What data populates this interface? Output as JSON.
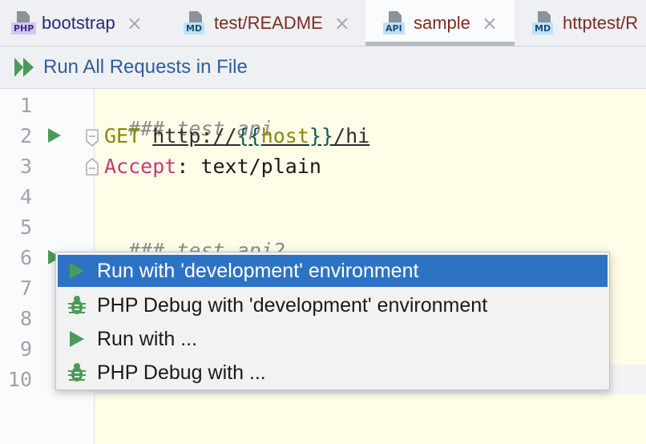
{
  "tabs": [
    {
      "icon_badge": "PHP",
      "icon": "php-file-icon",
      "title": "bootstrap",
      "active": false
    },
    {
      "icon_badge": "MD",
      "icon": "markdown-file-icon",
      "title": "test/README",
      "active": false
    },
    {
      "icon_badge": "API",
      "icon": "http-file-icon",
      "title": "sample",
      "active": true
    },
    {
      "icon_badge": "MD",
      "icon": "markdown-file-icon",
      "title": "httptest/R",
      "active": false
    }
  ],
  "toolbar": {
    "run_all_label": "Run All Requests in File"
  },
  "editor": {
    "line_numbers": [
      "1",
      "2",
      "3",
      "4",
      "5",
      "6",
      "7",
      "8",
      "9",
      "10"
    ],
    "lines": {
      "l1_comment": "### test api",
      "l2_method": "GET",
      "l2_url_prefix": "http://",
      "l2_open": "{{",
      "l2_var": "host",
      "l2_close": "}}",
      "l2_path": "/hi",
      "l3_header": "Accept",
      "l3_colon": ":",
      "l3_value": " text/plain",
      "l5_comment": "### test api2"
    }
  },
  "popup": {
    "items": [
      {
        "label": "Run with 'development' environment",
        "icon": "run-icon",
        "selected": true
      },
      {
        "label": "PHP Debug with 'development' environment",
        "icon": "debug-bug-icon",
        "selected": false
      },
      {
        "label": "Run with ...",
        "icon": "run-icon",
        "selected": false
      },
      {
        "label": "PHP Debug with ...",
        "icon": "debug-bug-icon",
        "selected": false
      }
    ]
  },
  "colors": {
    "accent": "#2d73c4",
    "run_green": "#4a9b5a",
    "editor_bg": "#fffce8"
  }
}
